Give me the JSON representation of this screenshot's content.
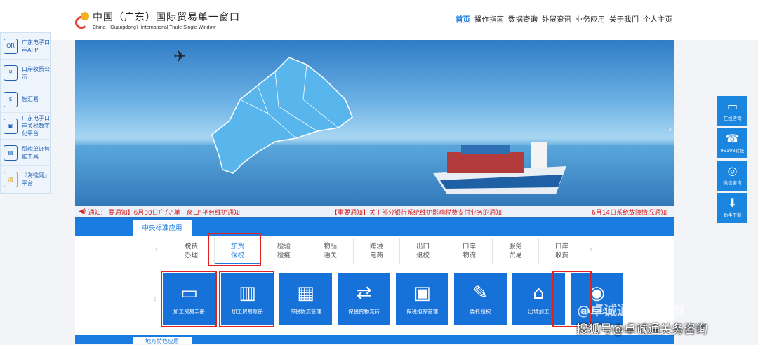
{
  "logo": {
    "cn": "中国（广东）国际贸易单一窗口",
    "en": "China（Guangdong）International Trade Single Window"
  },
  "nav": [
    "首页",
    "操作指南",
    "数据查询",
    "外贸资讯",
    "业务应用",
    "关于我们",
    "个人主页"
  ],
  "sidebar_left": [
    {
      "label": "广东电子口岸APP",
      "icon": "QR"
    },
    {
      "label": "口岸收费公示",
      "icon": "¥"
    },
    {
      "label": "智汇易",
      "icon": "$"
    },
    {
      "label": "广东电子口岸关税数字化平台",
      "icon": "▣"
    },
    {
      "label": "贸税单证智能工具",
      "icon": "▤"
    },
    {
      "label": "『海链网』平台",
      "icon": "海"
    }
  ],
  "sidebar_right": [
    {
      "label": "在线咨询",
      "icon": "chat-icon"
    },
    {
      "label": "95198转接",
      "icon": "phone-icon"
    },
    {
      "label": "微信咨询",
      "icon": "wechat-icon"
    },
    {
      "label": "助手下载",
      "icon": "download-icon"
    }
  ],
  "ticker": {
    "prefix": "通知:",
    "items": [
      "要通知】6月30日广东\"单一窗口\"平台维护通知",
      "【重要通知】关于部分银行系统维护影响税费支付业务的通知",
      "6月14日系统故障情况通知"
    ]
  },
  "panel": {
    "title": "中央标准应用",
    "subtabs": [
      "税费\n办理",
      "加贸\n保税",
      "检验\n检疫",
      "物品\n通关",
      "跨境\n电商",
      "出口\n退税",
      "口岸\n物流",
      "服务\n贸易",
      "口岸\n收费"
    ],
    "active_subtab": 1,
    "cards": [
      {
        "label": "加工贸易手册",
        "icon": "▭"
      },
      {
        "label": "加工贸易账册",
        "icon": "▥"
      },
      {
        "label": "保税物流管理",
        "icon": "▦"
      },
      {
        "label": "保税货物流转",
        "icon": "⇄"
      },
      {
        "label": "保税担保管理",
        "icon": "▣"
      },
      {
        "label": "委托授权",
        "icon": "✎"
      },
      {
        "label": "出境加工",
        "icon": "⌂"
      },
      {
        "label": "海关特殊监管",
        "icon": "◉"
      }
    ]
  },
  "next_section_title": "地方特色应用",
  "watermark": {
    "line1": "@卓诚通关务咨询",
    "line2": "搜狐号@卓诚通关务咨询"
  },
  "colors": {
    "primary": "#1a7be0",
    "highlight": "#e3211c",
    "ticker": "#d81e1e"
  }
}
